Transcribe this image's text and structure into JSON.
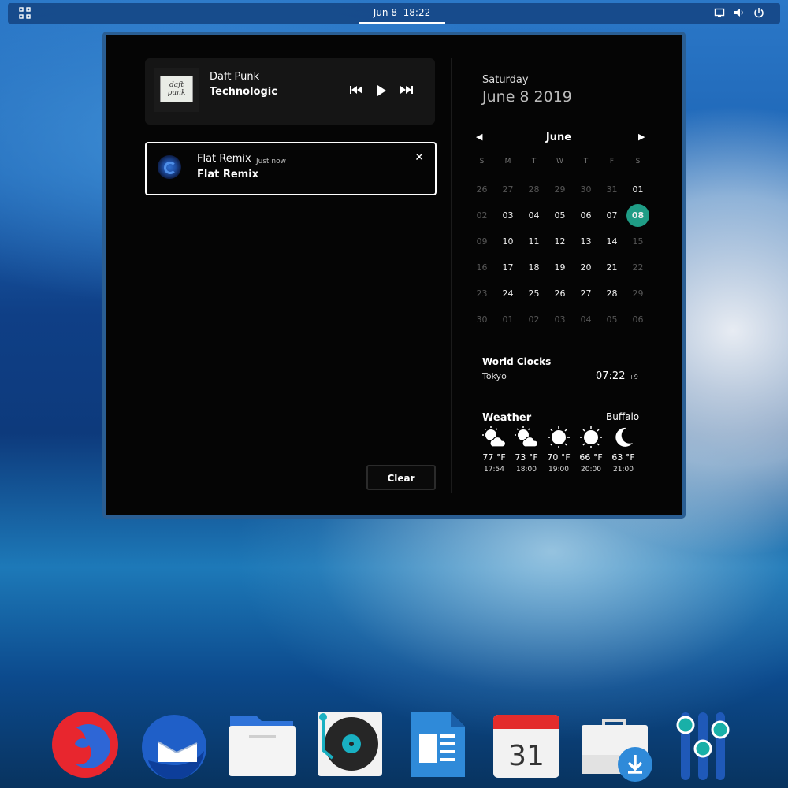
{
  "topbar": {
    "date": "Jun 8",
    "time": "18:22"
  },
  "media": {
    "album_art_text": "daft punk",
    "artist": "Daft Punk",
    "track": "Technologic"
  },
  "notification": {
    "title": "Flat Remix",
    "time": "Just now",
    "body": "Flat Remix"
  },
  "clear_label": "Clear",
  "date": {
    "day_name": "Saturday",
    "full": "June 8 2019"
  },
  "calendar": {
    "month": "June",
    "weekdays": [
      "S",
      "M",
      "T",
      "W",
      "T",
      "F",
      "S"
    ],
    "weeks": [
      [
        "26",
        "27",
        "28",
        "29",
        "30",
        "31",
        "01"
      ],
      [
        "02",
        "03",
        "04",
        "05",
        "06",
        "07",
        "08"
      ],
      [
        "09",
        "10",
        "11",
        "12",
        "13",
        "14",
        "15"
      ],
      [
        "16",
        "17",
        "18",
        "19",
        "20",
        "21",
        "22"
      ],
      [
        "23",
        "24",
        "25",
        "26",
        "27",
        "28",
        "29"
      ],
      [
        "30",
        "01",
        "02",
        "03",
        "04",
        "05",
        "06"
      ]
    ],
    "selected": "08"
  },
  "world_clocks": {
    "title": "World Clocks",
    "city": "Tokyo",
    "time": "07:22",
    "offset": "+9"
  },
  "weather": {
    "title": "Weather",
    "location": "Buffalo",
    "forecast": [
      {
        "icon": "partly-cloudy-icon",
        "temp": "77 °F",
        "time": "17:54"
      },
      {
        "icon": "partly-cloudy-icon",
        "temp": "73 °F",
        "time": "18:00"
      },
      {
        "icon": "sun-icon",
        "temp": "70 °F",
        "time": "19:00"
      },
      {
        "icon": "sun-icon",
        "temp": "66 °F",
        "time": "20:00"
      },
      {
        "icon": "moon-icon",
        "temp": "63 °F",
        "time": "21:00"
      }
    ]
  },
  "dock": {
    "calendar_day": "31"
  },
  "colors": {
    "accent": "#1f9d86",
    "topbar": "#164887",
    "panel": "#050505"
  }
}
